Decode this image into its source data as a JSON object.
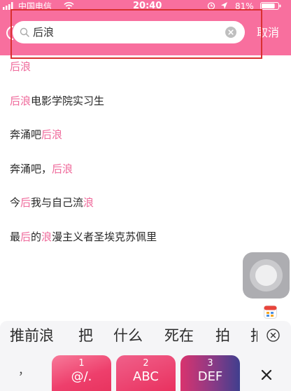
{
  "status_bar": {
    "carrier": "中国电信",
    "time": "20:40",
    "battery": "81%"
  },
  "search": {
    "query": "后浪",
    "cancel_label": "取消",
    "search_icon": "search-icon",
    "clear_icon": "clear-icon"
  },
  "suggestions": [
    {
      "segments": [
        {
          "text": "后浪",
          "highlight": true
        }
      ]
    },
    {
      "segments": [
        {
          "text": "后浪",
          "highlight": true
        },
        {
          "text": "电影学院实习生",
          "highlight": false
        }
      ]
    },
    {
      "segments": [
        {
          "text": "奔涌吧",
          "highlight": false
        },
        {
          "text": "后浪",
          "highlight": true
        }
      ]
    },
    {
      "segments": [
        {
          "text": "奔涌吧，",
          "highlight": false
        },
        {
          "text": "后浪",
          "highlight": true
        }
      ]
    },
    {
      "segments": [
        {
          "text": "今",
          "highlight": false
        },
        {
          "text": "后",
          "highlight": true
        },
        {
          "text": "我与自己流",
          "highlight": false
        },
        {
          "text": "浪",
          "highlight": true
        }
      ]
    },
    {
      "segments": [
        {
          "text": "最",
          "highlight": false
        },
        {
          "text": "后",
          "highlight": true
        },
        {
          "text": "的",
          "highlight": false
        },
        {
          "text": "浪",
          "highlight": true
        },
        {
          "text": "漫主义者圣埃克苏佩里",
          "highlight": false
        }
      ]
    }
  ],
  "keyboard": {
    "candidates": [
      "推前浪",
      "把",
      "什么",
      "死在",
      "拍",
      "拍"
    ],
    "comma": "，",
    "keys": [
      {
        "number": "1",
        "label": "@/."
      },
      {
        "number": "2",
        "label": "ABC"
      },
      {
        "number": "3",
        "label": "DEF"
      }
    ],
    "delete_icon": "close-icon",
    "collapse_icon": "close-circle-icon"
  },
  "floating_button": {
    "icon": "assistive-touch-icon"
  },
  "colors": {
    "header": "#f86f9e",
    "highlight_text": "#ef6a9b",
    "annotation_box": "#d93030",
    "key_pink": "#ee3f6c",
    "key_blue": "#3f3f8e"
  }
}
